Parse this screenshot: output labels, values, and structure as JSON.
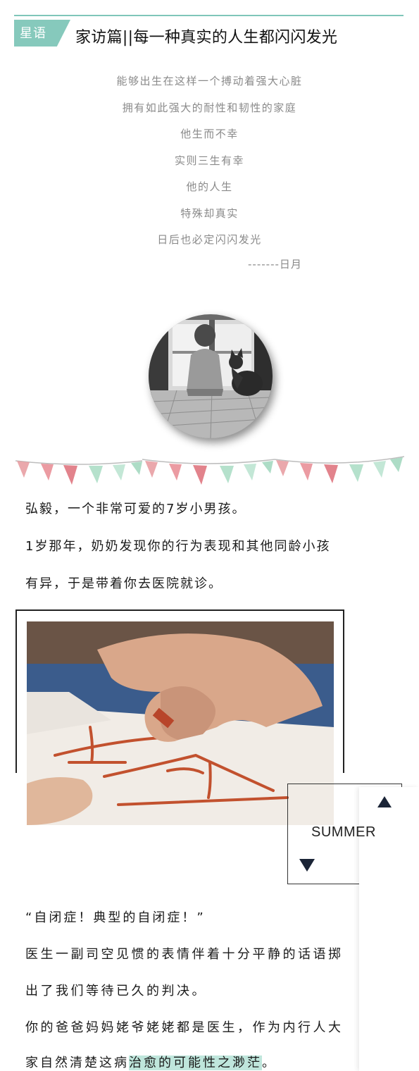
{
  "header": {
    "tag": "星语",
    "title": "家访篇||每一种真实的人生都闪闪发光",
    "accent_color": "#86c9bc"
  },
  "poem": {
    "lines": [
      "能够出生在这样一个搏动着强大心脏",
      "拥有如此强大的耐性和韧性的家庭",
      "他生而不幸",
      "实则三生有幸",
      "他的人生",
      "特殊却真实",
      "日后也必定闪闪发光"
    ],
    "signature": "-------日月"
  },
  "body": {
    "p1": "弘毅，一个非常可爱的7岁小男孩。",
    "p2_line1": "1岁那年，奶奶发现你的行为表现和其他同龄小孩",
    "p2_line2": "有异，于是带着你去医院就诊。",
    "p3": "“自闭症！典型的自闭症！”",
    "p4_line1": "医生一副司空见惯的表情伴着十分平静的话语掷",
    "p4_line2": "出了我们等待已久的判决。",
    "p5_line1": "你的爸爸妈妈姥爷姥姥都是医生，作为内行人大",
    "p5_line2_prefix": "家自然清楚这病",
    "p5_line2_highlight": "治愈的可能性之渺茫",
    "p5_line2_suffix": "。",
    "highlight_color": "#bfe6dc"
  },
  "summer_widget": {
    "label": "SUMMER"
  }
}
